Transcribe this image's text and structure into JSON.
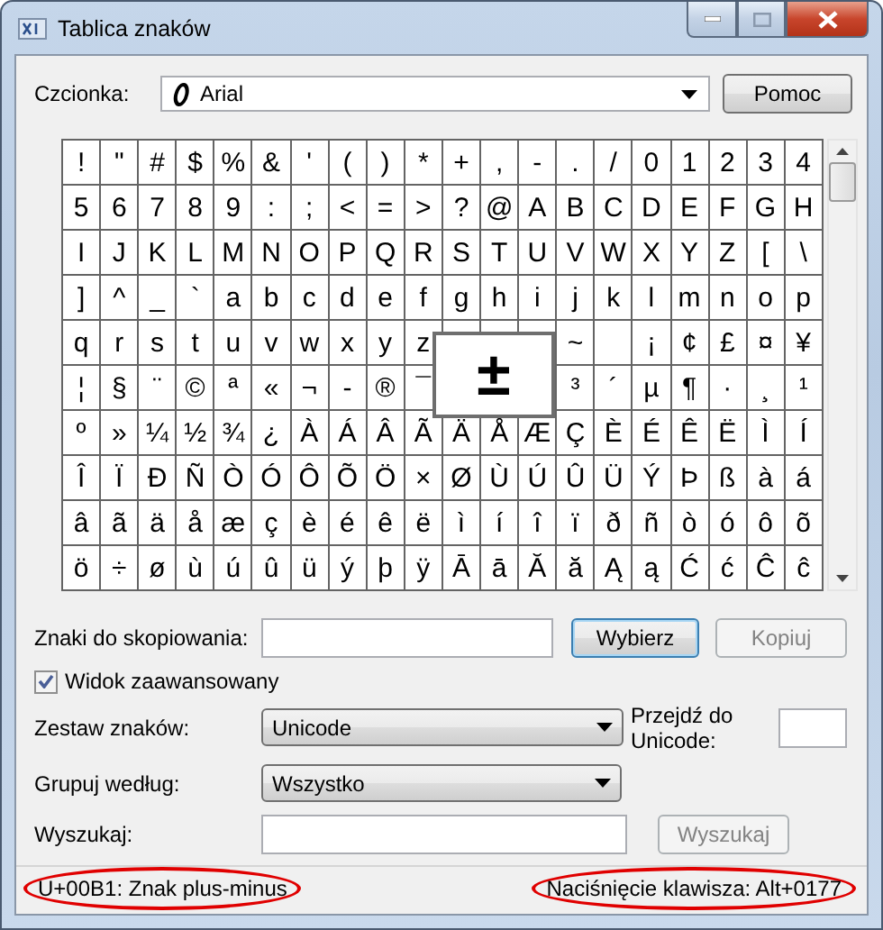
{
  "window": {
    "title": "Tablica znaków"
  },
  "font": {
    "label": "Czcionka:",
    "value": "Arial"
  },
  "help_button": {
    "label": "Pomoc"
  },
  "grid": {
    "rows": [
      [
        "!",
        "\"",
        "#",
        "$",
        "%",
        "&",
        "'",
        "(",
        ")",
        "*",
        "+",
        ",",
        "-",
        ".",
        "/",
        "0",
        "1",
        "2",
        "3",
        "4"
      ],
      [
        "5",
        "6",
        "7",
        "8",
        "9",
        ":",
        ";",
        "<",
        "=",
        ">",
        "?",
        "@",
        "A",
        "B",
        "C",
        "D",
        "E",
        "F",
        "G",
        "H"
      ],
      [
        "I",
        "J",
        "K",
        "L",
        "M",
        "N",
        "O",
        "P",
        "Q",
        "R",
        "S",
        "T",
        "U",
        "V",
        "W",
        "X",
        "Y",
        "Z",
        "[",
        "\\"
      ],
      [
        "]",
        "^",
        "_",
        "`",
        "a",
        "b",
        "c",
        "d",
        "e",
        "f",
        "g",
        "h",
        "i",
        "j",
        "k",
        "l",
        "m",
        "n",
        "o",
        "p"
      ],
      [
        "q",
        "r",
        "s",
        "t",
        "u",
        "v",
        "w",
        "x",
        "y",
        "z",
        null,
        null,
        null,
        "~",
        " ",
        "¡",
        "¢",
        "£",
        "¤",
        "¥"
      ],
      [
        "¦",
        "§",
        "¨",
        "©",
        "ª",
        "«",
        "¬",
        "-",
        "®",
        "¯",
        null,
        null,
        null,
        "³",
        "´",
        "µ",
        "¶",
        "·",
        "¸",
        "¹"
      ],
      [
        "º",
        "»",
        "¼",
        "½",
        "¾",
        "¿",
        "À",
        "Á",
        "Â",
        "Ã",
        "Ä",
        "Å",
        "Æ",
        "Ç",
        "È",
        "É",
        "Ê",
        "Ë",
        "Ì",
        "Í"
      ],
      [
        "Î",
        "Ï",
        "Ð",
        "Ñ",
        "Ò",
        "Ó",
        "Ô",
        "Õ",
        "Ö",
        "×",
        "Ø",
        "Ù",
        "Ú",
        "Û",
        "Ü",
        "Ý",
        "Þ",
        "ß",
        "à",
        "á"
      ],
      [
        "â",
        "ã",
        "ä",
        "å",
        "æ",
        "ç",
        "è",
        "é",
        "ê",
        "ë",
        "ì",
        "í",
        "î",
        "ï",
        "ð",
        "ñ",
        "ò",
        "ó",
        "ô",
        "õ"
      ],
      [
        "ö",
        "÷",
        "ø",
        "ù",
        "ú",
        "û",
        "ü",
        "ý",
        "þ",
        "ÿ",
        "Ā",
        "ā",
        "Ă",
        "ă",
        "Ą",
        "ą",
        "Ć",
        "ć",
        "Ĉ",
        "ĉ"
      ]
    ],
    "magnified": "±"
  },
  "copy": {
    "label": "Znaki do skopiowania:"
  },
  "select_button": {
    "label": "Wybierz",
    "disabled": false
  },
  "copy_button": {
    "label": "Kopiuj",
    "disabled": true
  },
  "advanced_view": {
    "label": "Widok zaawansowany",
    "checked": true
  },
  "charset": {
    "label": "Zestaw znaków:",
    "value": "Unicode"
  },
  "goto_unicode": {
    "label": "Przejdź do Unicode:"
  },
  "group_by": {
    "label": "Grupuj według:",
    "value": "Wszystko"
  },
  "search": {
    "label": "Wyszukaj:"
  },
  "search_button": {
    "label": "Wyszukaj",
    "disabled": true
  },
  "status_bar": [
    {
      "text": "U+00B1: Znak plus-minus",
      "circled": true
    },
    {
      "text": "Naciśnięcie klawisza: Alt+0177",
      "circled": true
    }
  ]
}
